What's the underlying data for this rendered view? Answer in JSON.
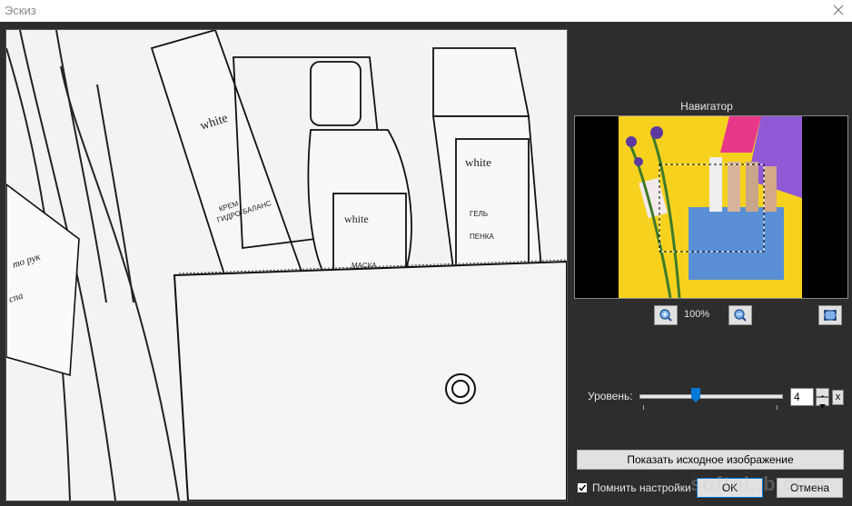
{
  "window": {
    "title": "Эскиз"
  },
  "navigator": {
    "title": "Навигатор",
    "zoom": "100%"
  },
  "settings": {
    "level_label": "Уровень:",
    "level_value": "4",
    "level_slider_fraction": 0.4,
    "multiplier": "x"
  },
  "buttons": {
    "show_original": "Показать исходное изображение",
    "ok": "OK",
    "cancel": "Отмена"
  },
  "remember": {
    "label": "Помнить настройки",
    "checked": true
  },
  "watermark": "softol..b.com",
  "icons": [
    "close-icon",
    "zoom-in-icon",
    "zoom-out-icon",
    "fit-screen-icon",
    "checkmark-icon"
  ],
  "colors": {
    "window_bg": "#2d2d2d",
    "accent": "#0078d7",
    "nav_yellow": "#f6d21f",
    "nav_pink": "#e8388a",
    "nav_purple": "#9159d6",
    "nav_blue_bag": "#5a8fd6"
  }
}
